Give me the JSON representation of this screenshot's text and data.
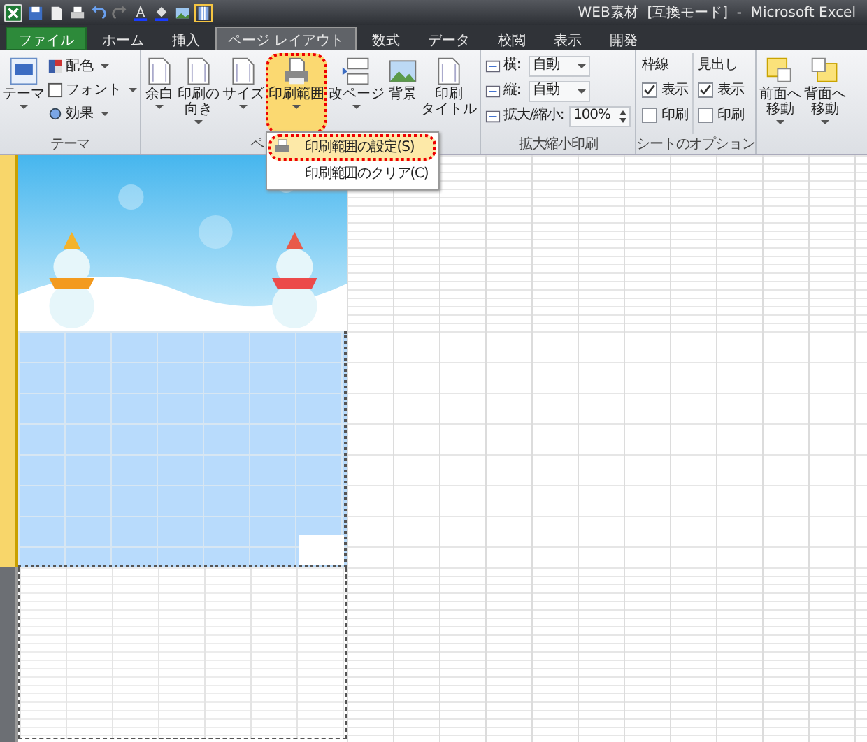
{
  "title_bar": {
    "title": "WEB素材  [互換モード]  -  Microsoft Excel"
  },
  "tabs": [
    {
      "label": "ファイル",
      "kind": "file",
      "selected": false
    },
    {
      "label": "ホーム",
      "kind": "tab",
      "selected": false
    },
    {
      "label": "挿入",
      "kind": "tab",
      "selected": false
    },
    {
      "label": "ページ レイアウト",
      "kind": "tab",
      "selected": true
    },
    {
      "label": "数式",
      "kind": "tab",
      "selected": false
    },
    {
      "label": "データ",
      "kind": "tab",
      "selected": false
    },
    {
      "label": "校閲",
      "kind": "tab",
      "selected": false
    },
    {
      "label": "表示",
      "kind": "tab",
      "selected": false
    },
    {
      "label": "開発",
      "kind": "tab",
      "selected": false
    }
  ],
  "theme_group": {
    "label": "テーマ",
    "button": {
      "lines": [
        "テーマ"
      ],
      "dropdown": true
    },
    "items": [
      {
        "label": "配色",
        "dropdown": true
      },
      {
        "label": "フォント",
        "dropdown": true
      },
      {
        "label": "効果",
        "dropdown": true
      }
    ]
  },
  "page_setup_group": {
    "label": "ペ",
    "buttons": [
      {
        "lines": [
          "余白"
        ],
        "dropdown": true,
        "highlighted": false
      },
      {
        "lines": [
          "印刷の",
          "向き"
        ],
        "dropdown": true,
        "highlighted": false
      },
      {
        "lines": [
          "サイズ"
        ],
        "dropdown": true,
        "highlighted": false
      },
      {
        "lines": [
          "印刷範囲"
        ],
        "dropdown": true,
        "highlighted": true
      },
      {
        "lines": [
          "改ページ"
        ],
        "dropdown": true,
        "highlighted": false
      },
      {
        "lines": [
          "背景"
        ],
        "dropdown": false,
        "highlighted": false
      },
      {
        "lines": [
          "印刷",
          "タイトル"
        ],
        "dropdown": false,
        "highlighted": false
      }
    ]
  },
  "scale_group": {
    "label": "拡大縮小印刷",
    "rows": [
      {
        "label": "横:",
        "value": "自動",
        "kind": "select"
      },
      {
        "label": "縦:",
        "value": "自動",
        "kind": "select"
      },
      {
        "label": "拡大/縮小:",
        "value": "100%",
        "kind": "spin"
      }
    ]
  },
  "sheet_options_group": {
    "label": "シートのオプション",
    "columns": [
      {
        "heading": "枠線",
        "options": [
          {
            "label": "表示",
            "checked": true
          },
          {
            "label": "印刷",
            "checked": false
          }
        ]
      },
      {
        "heading": "見出し",
        "options": [
          {
            "label": "表示",
            "checked": true
          },
          {
            "label": "印刷",
            "checked": false
          }
        ]
      }
    ]
  },
  "arrange_group": {
    "buttons": [
      {
        "lines": [
          "前面へ",
          "移動"
        ],
        "dropdown": true
      },
      {
        "lines": [
          "背面へ",
          "移動"
        ],
        "dropdown": true
      }
    ]
  },
  "print_area_menu": {
    "items": [
      {
        "label": "印刷範囲の設定(S)",
        "selected": true
      },
      {
        "label": "印刷範囲のクリア(C)",
        "selected": false
      }
    ]
  }
}
